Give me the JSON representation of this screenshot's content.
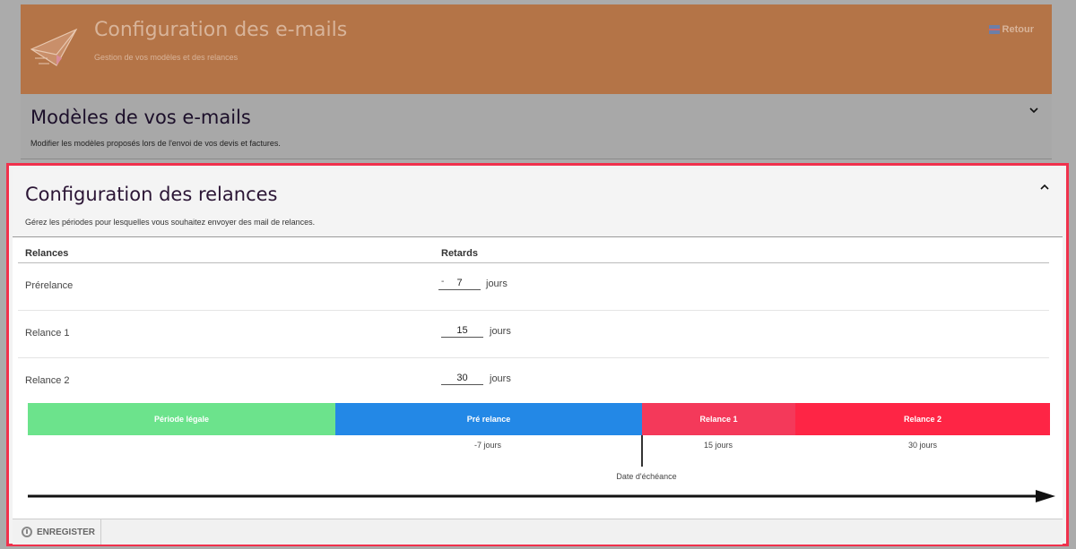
{
  "header": {
    "title": "Configuration des e-mails",
    "subtitle": "Gestion de vos modèles et des relances",
    "back_label": "Retour",
    "bg_color": "#b47447"
  },
  "models": {
    "title": "Modèles de vos e-mails",
    "description": "Modifier les modèles proposés lors de l'envoi de vos devis et factures.",
    "toggle_icon": "chevron-down-icon"
  },
  "relances": {
    "title": "Configuration des relances",
    "description": "Gérez les périodes pour lesquelles vous souhaitez envoyer des mail de relances.",
    "toggle_icon": "chevron-up-icon",
    "columns": {
      "relances": "Relances",
      "retards": "Retards"
    },
    "rows": [
      {
        "label": "Prérelance",
        "value": "7",
        "prefix": "-",
        "unit": "jours"
      },
      {
        "label": "Relance 1",
        "value": "15",
        "prefix": "",
        "unit": "jours"
      },
      {
        "label": "Relance 2",
        "value": "30",
        "prefix": "",
        "unit": "jours"
      }
    ],
    "timeline": {
      "segments": [
        {
          "label": "Période légale",
          "color": "#6ce38c"
        },
        {
          "label": "Pré relance",
          "color": "#2388e6"
        },
        {
          "label": "Relance 1",
          "color": "#f4395a"
        },
        {
          "label": "Relance 2",
          "color": "#fe2545"
        }
      ],
      "tick_labels": [
        "-7 jours",
        "15 jours",
        "30 jours"
      ],
      "due_date_label": "Date d'échéance"
    },
    "highlight_color": "#f0314c"
  },
  "footer": {
    "save_label": "ENREGISTER"
  }
}
